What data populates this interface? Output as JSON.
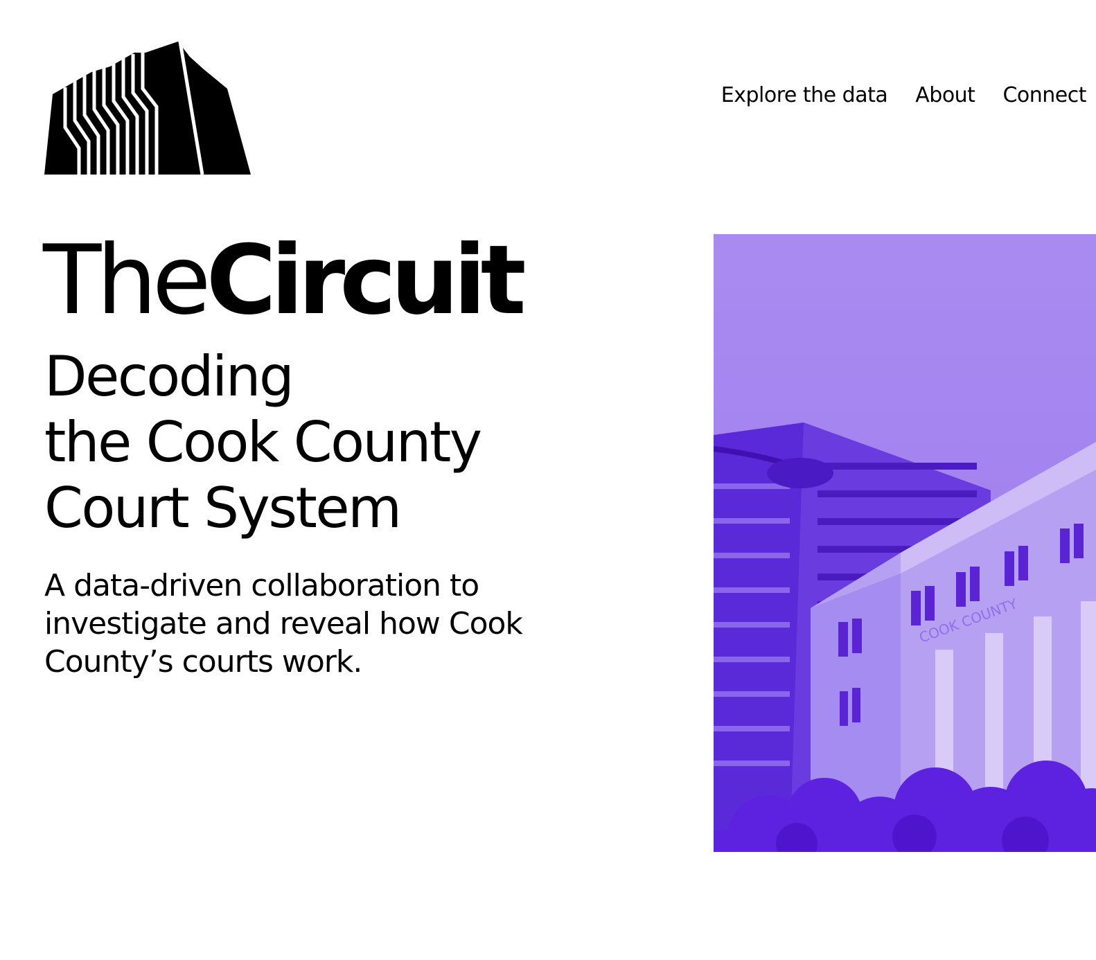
{
  "logo": {
    "name": "building-logo"
  },
  "nav": {
    "items": [
      {
        "label": "Explore the data"
      },
      {
        "label": "About"
      },
      {
        "label": "Connect"
      }
    ]
  },
  "brand": {
    "part1": "The",
    "part2": "Circuit"
  },
  "headline": {
    "lines": [
      "Decoding",
      "the Cook County",
      "Court System"
    ]
  },
  "lede": "A data-driven collaboration to investigate and reveal how Cook County’s courts work.",
  "hero": {
    "engraving": "COOK COUNTY",
    "tint": "#6a2cf2",
    "sky": "#a989f0"
  }
}
